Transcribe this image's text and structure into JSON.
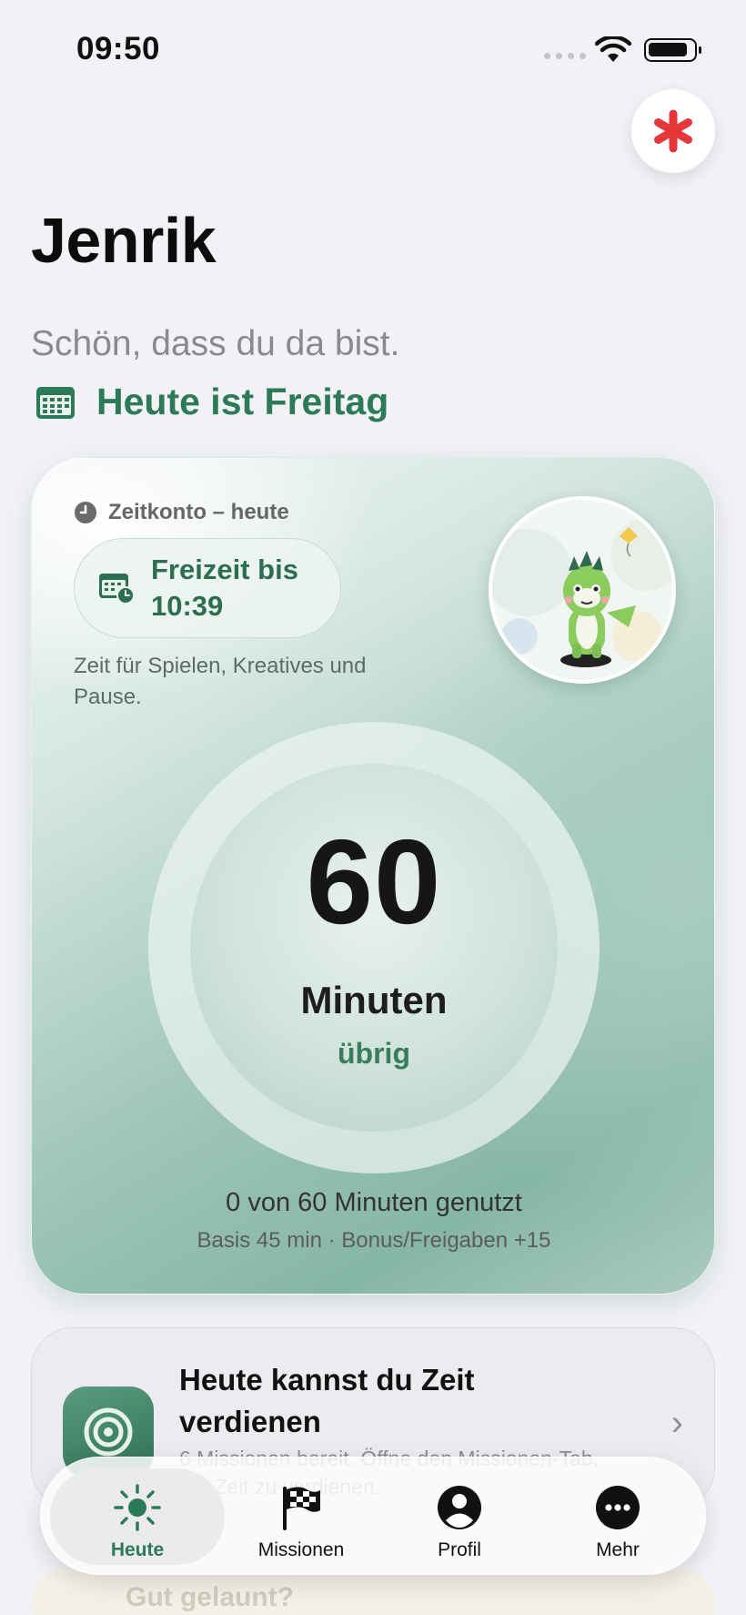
{
  "status_bar": {
    "time": "09:50"
  },
  "header": {
    "title": "Jenrik",
    "greeting": "Schön, dass du da bist.",
    "day_label": "Heute ist Freitag"
  },
  "time_card": {
    "account_label": "Zeitkonto – heute",
    "freetime_line1": "Freizeit bis",
    "freetime_line2": "10:39",
    "description": "Zeit für Spielen, Kreatives und Pause.",
    "minutes_value": "60",
    "minutes_unit": "Minuten",
    "minutes_state": "übrig",
    "usage_text": "0 von 60 Minuten genutzt",
    "basis_text": "Basis 45 min · Bonus/Freigaben +15",
    "minutes_used": 0,
    "minutes_total": 60
  },
  "earn_card": {
    "title": "Heute kannst du Zeit verdienen",
    "subtitle": "6 Missionen bereit. Öffne den Missionen-Tab, um Zeit zu verdienen."
  },
  "peek_card": {
    "text": "Gut gelaunt?"
  },
  "tab_bar": {
    "tabs": [
      {
        "label": "Heute",
        "icon": "sun-icon",
        "active": true
      },
      {
        "label": "Missionen",
        "icon": "checkered-flag-icon",
        "active": false
      },
      {
        "label": "Profil",
        "icon": "person-icon",
        "active": false
      },
      {
        "label": "Mehr",
        "icon": "more-icon",
        "active": false
      }
    ]
  },
  "colors": {
    "accent_green": "#2c7a57",
    "sos_red": "#e5373a",
    "background": "#f2f2f6"
  }
}
